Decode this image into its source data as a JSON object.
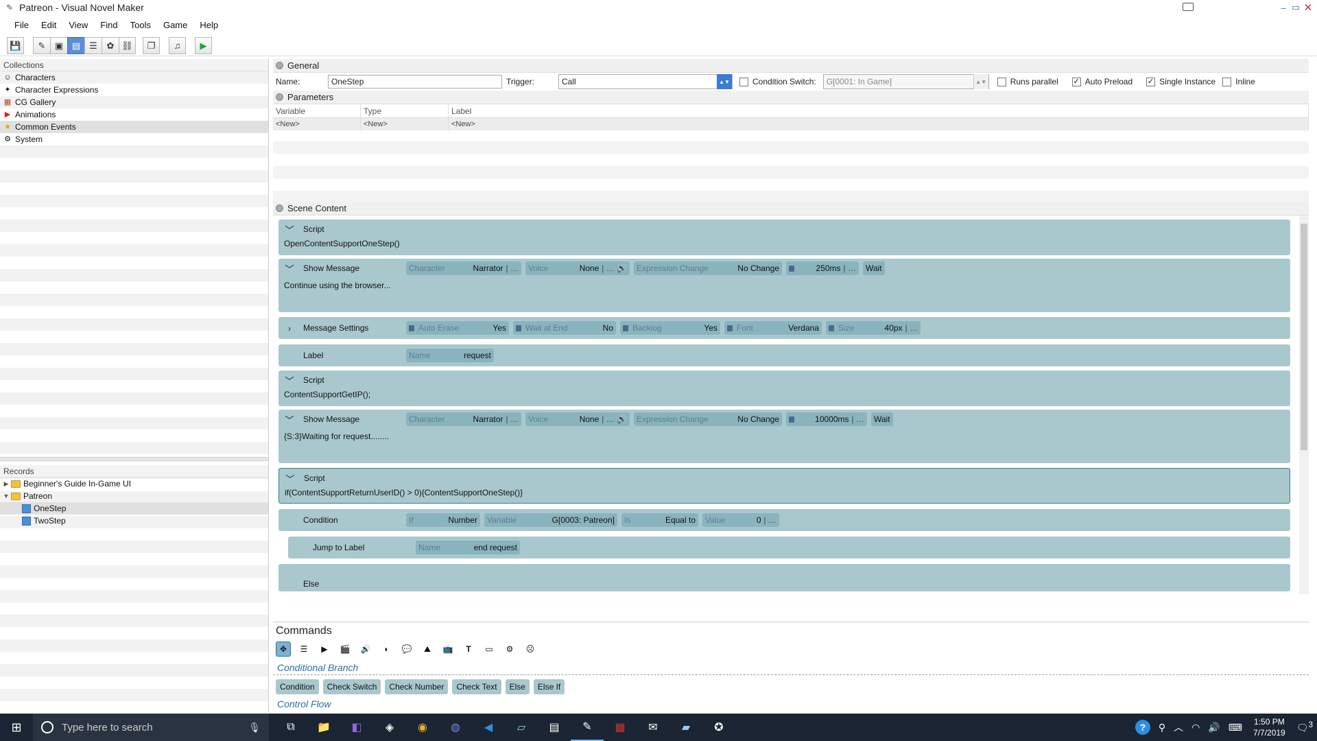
{
  "window": {
    "title": "Patreon - Visual Novel Maker"
  },
  "menubar": [
    "File",
    "Edit",
    "View",
    "Find",
    "Tools",
    "Game",
    "Help"
  ],
  "collections": {
    "header": "Collections",
    "items": [
      {
        "label": "Characters",
        "icon": "character-icon"
      },
      {
        "label": "Character Expressions",
        "icon": "expressions-icon"
      },
      {
        "label": "CG Gallery",
        "icon": "gallery-icon"
      },
      {
        "label": "Animations",
        "icon": "animation-icon"
      },
      {
        "label": "Common Events",
        "icon": "star-icon"
      },
      {
        "label": "System",
        "icon": "gear-icon"
      }
    ]
  },
  "records": {
    "header": "Records",
    "items": [
      {
        "label": "Beginner's Guide In-Game UI"
      },
      {
        "label": "Patreon"
      },
      {
        "label": "OneStep"
      },
      {
        "label": "TwoStep"
      }
    ]
  },
  "general": {
    "header": "General",
    "name_label": "Name:",
    "name_value": "OneStep",
    "trigger_label": "Trigger:",
    "trigger_value": "Call",
    "condition_switch_label": "Condition Switch:",
    "condition_switch_value": "G[0001: In Game]",
    "runs_parallel": "Runs parallel",
    "auto_preload": "Auto Preload",
    "single_instance": "Single Instance",
    "inline": "Inline"
  },
  "parameters": {
    "header": "Parameters",
    "columns": [
      "Variable",
      "Type",
      "Label"
    ],
    "new_row": [
      "<New>",
      "<New>",
      "<New>"
    ]
  },
  "scene": {
    "header": "Scene Content",
    "commands": [
      {
        "name": "Script",
        "body": "OpenContentSupportOneStep()"
      },
      {
        "name": "Show Message",
        "character_lbl": "Character",
        "character": "Narrator",
        "voice_lbl": "Voice",
        "voice": "None",
        "expr_lbl": "Expression Change",
        "expr": "No Change",
        "delay": "250ms",
        "wait": "Wait",
        "body": "Continue using the browser..."
      },
      {
        "name": "Message Settings",
        "f1_lbl": "Auto Erase",
        "f1": "Yes",
        "f2_lbl": "Wait at End",
        "f2": "No",
        "f3_lbl": "Backlog",
        "f3": "Yes",
        "f4_lbl": "Font",
        "f4": "Verdana",
        "f5_lbl": "Size",
        "f5": "40px"
      },
      {
        "name": "Label",
        "f_lbl": "Name",
        "f": "request"
      },
      {
        "name": "Script",
        "body": "ContentSupportGetIP();"
      },
      {
        "name": "Show Message",
        "character_lbl": "Character",
        "character": "Narrator",
        "voice_lbl": "Voice",
        "voice": "None",
        "expr_lbl": "Expression Change",
        "expr": "No Change",
        "delay": "10000ms",
        "wait": "Wait",
        "body": "{S:3}Waiting for request........"
      },
      {
        "name": "Script",
        "body": "if(ContentSupportReturnUserID() > 0){ContentSupportOneStep()}"
      },
      {
        "name": "Condition",
        "f1_lbl": "If",
        "f1": "Number",
        "f2_lbl": "Variable",
        "f2": "G[0003: Patreon]",
        "f3_lbl": "Is",
        "f3": "Equal to",
        "f4_lbl": "Value",
        "f4": "0"
      },
      {
        "name": "Jump to Label",
        "f_lbl": "Name",
        "f": "end request"
      },
      {
        "name": "Else"
      }
    ]
  },
  "commands_panel": {
    "title": "Commands",
    "category": "Conditional Branch",
    "buttons": [
      "Condition",
      "Check Switch",
      "Check Number",
      "Check Text",
      "Else",
      "Else If"
    ],
    "next_category": "Control Flow"
  },
  "taskbar": {
    "search_placeholder": "Type here to search",
    "time": "1:50 PM",
    "date": "7/7/2019",
    "notifications": "3"
  }
}
